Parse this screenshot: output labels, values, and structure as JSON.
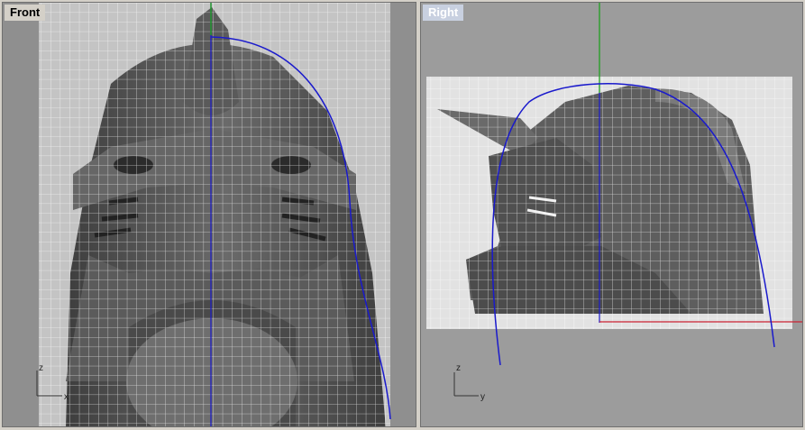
{
  "viewports": {
    "front": {
      "title": "Front",
      "axes": {
        "vertical": "z",
        "horizontal": "x"
      }
    },
    "right": {
      "title": "Right",
      "axes": {
        "vertical": "z",
        "horizontal": "y"
      }
    }
  },
  "colors": {
    "curve": "#1a1acc",
    "z_axis_front": "#1a1acc",
    "y_axis_right": "#22a022",
    "x_axis_right": "#cc2233",
    "grid": "#ffffff"
  },
  "icons": [
    "axis-triad-icon"
  ]
}
